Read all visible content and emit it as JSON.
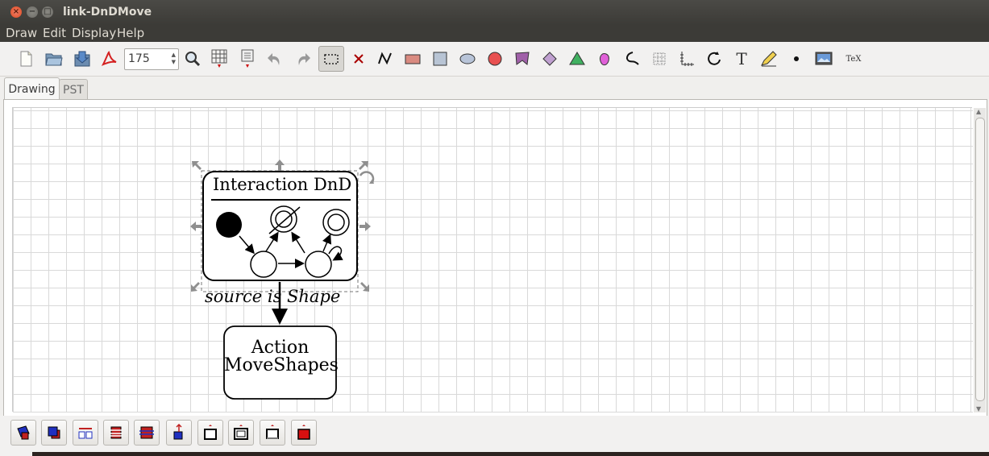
{
  "window": {
    "title": "link-DnDMove"
  },
  "menu": [
    "Draw",
    "Edit",
    "Display",
    "Help"
  ],
  "toolbar": {
    "zoom_value": "175",
    "tex_label": "TeX",
    "icons": [
      "new-file-icon",
      "open-folder-icon",
      "save-icon",
      "pdf-export-icon",
      "zoom-icon",
      "grid-icon",
      "magnetic-grid-icon",
      "undo-icon",
      "redo-icon",
      "select-icon",
      "delete-icon",
      "polyline-icon",
      "rectangle-icon",
      "square-icon",
      "ellipse-icon",
      "circle-icon",
      "polygon-icon",
      "rhombus-icon",
      "triangle-icon",
      "freehand-icon",
      "bezier-icon",
      "plot-icon",
      "axes-icon",
      "arc-icon",
      "text-icon",
      "pencil-icon",
      "dot-icon",
      "picture-icon"
    ]
  },
  "tabs": {
    "drawing": "Drawing",
    "pst": "PST"
  },
  "canvas": {
    "interaction_title": "Interaction DnD",
    "link_label": "source is Shape",
    "action_line1": "Action",
    "action_line2": "MoveShapes"
  },
  "bottom_toolbar": [
    "join-icon",
    "separate-icon",
    "distribute-icon",
    "align-left-icon",
    "align-center-icon",
    "bring-front-icon",
    "send-back-icon",
    "raise-icon",
    "lower-icon",
    "fill-icon"
  ],
  "colors": {
    "accent_close": "#e0491f",
    "titlebar": "#3c3b37",
    "grid": "#d9d9d9"
  }
}
